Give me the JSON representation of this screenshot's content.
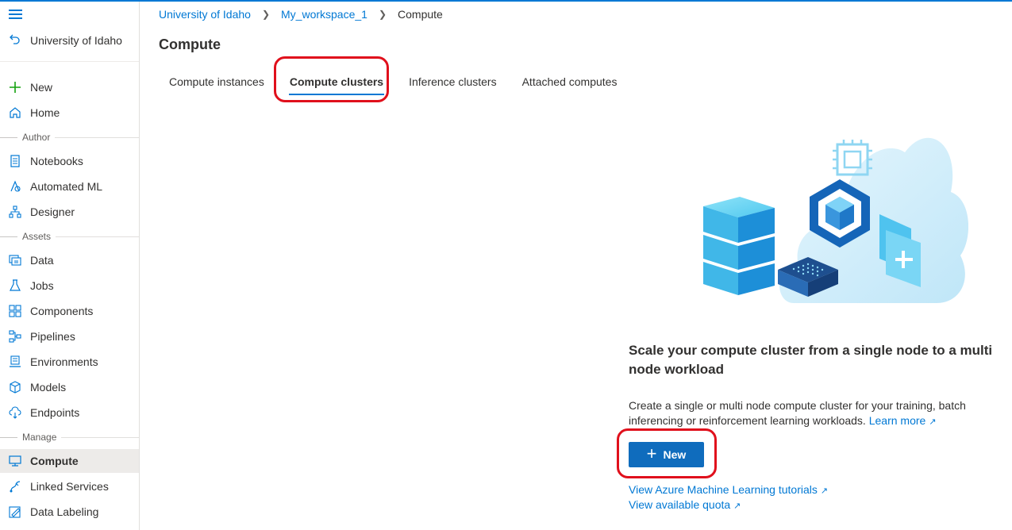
{
  "sidebar": {
    "back_label": "University of Idaho",
    "new_label": "New",
    "home_label": "Home",
    "author_section": "Author",
    "author_items": [
      {
        "label": "Notebooks",
        "icon": "notebook-icon"
      },
      {
        "label": "Automated ML",
        "icon": "automated-ml-icon"
      },
      {
        "label": "Designer",
        "icon": "designer-icon"
      }
    ],
    "assets_section": "Assets",
    "assets_items": [
      {
        "label": "Data",
        "icon": "data-icon"
      },
      {
        "label": "Jobs",
        "icon": "jobs-flask-icon"
      },
      {
        "label": "Components",
        "icon": "components-icon"
      },
      {
        "label": "Pipelines",
        "icon": "pipelines-icon"
      },
      {
        "label": "Environments",
        "icon": "environments-icon"
      },
      {
        "label": "Models",
        "icon": "models-cube-icon"
      },
      {
        "label": "Endpoints",
        "icon": "endpoints-cloud-icon"
      }
    ],
    "manage_section": "Manage",
    "manage_items": [
      {
        "label": "Compute",
        "icon": "compute-monitor-icon",
        "active": true
      },
      {
        "label": "Linked Services",
        "icon": "linked-services-icon"
      },
      {
        "label": "Data Labeling",
        "icon": "data-labeling-icon"
      }
    ]
  },
  "breadcrumb": {
    "items": [
      "University of Idaho",
      "My_workspace_1"
    ],
    "current": "Compute"
  },
  "page": {
    "title": "Compute",
    "tabs": [
      {
        "label": "Compute instances"
      },
      {
        "label": "Compute clusters",
        "active": true
      },
      {
        "label": "Inference clusters"
      },
      {
        "label": "Attached computes"
      }
    ]
  },
  "empty_state": {
    "heading": "Scale your compute cluster from a single node to a multi node workload",
    "description": "Create a single or multi node compute cluster for your training, batch inferencing or reinforcement learning workloads.",
    "learn_more": "Learn more",
    "new_button": "New",
    "tutorials_link": "View Azure Machine Learning tutorials",
    "quota_link": "View available quota"
  },
  "colors": {
    "accent": "#0078d4",
    "annotation": "#e0101c",
    "button": "#0f6cbd"
  }
}
